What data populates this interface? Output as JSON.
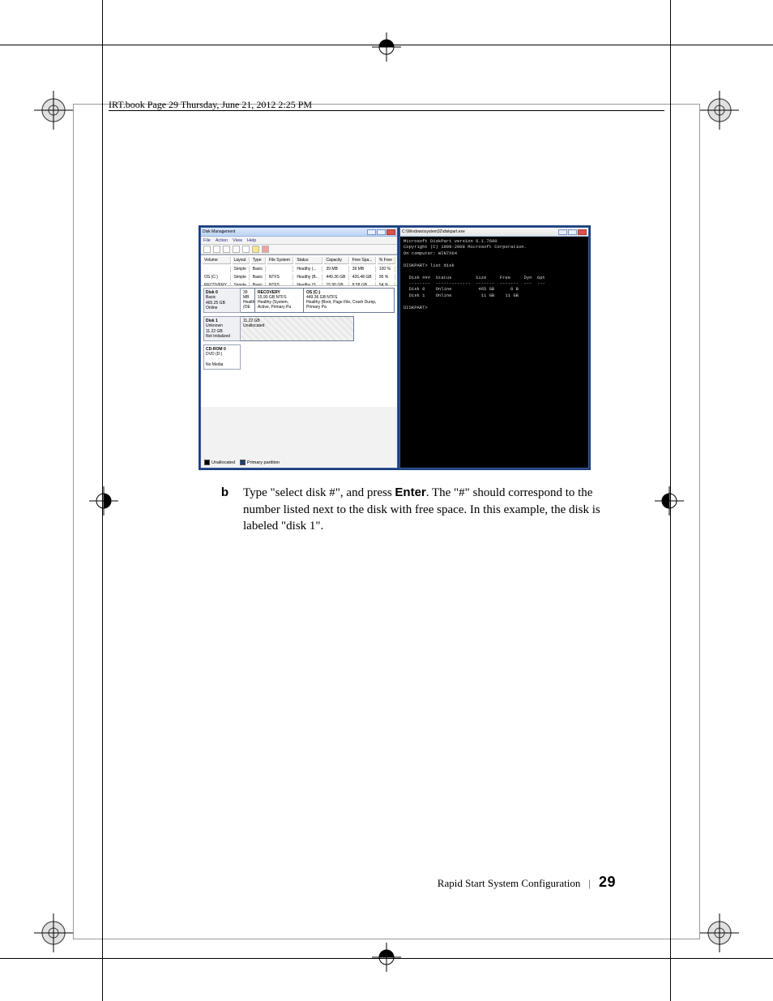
{
  "header_line": "IRT.book  Page 29  Thursday, June 21, 2012  2:25 PM",
  "screenshot": {
    "disk_management": {
      "title": "Disk Management",
      "menus": [
        "File",
        "Action",
        "View",
        "Help"
      ],
      "columns": [
        "Volume",
        "Layout",
        "Type",
        "File System",
        "Status",
        "Capacity",
        "Free Spa...",
        "% Free"
      ],
      "rows": [
        {
          "Volume": "",
          "Layout": "Simple",
          "Type": "Basic",
          "File System": "",
          "Status": "Healthy (...",
          "Capacity": "39 MB",
          "Free Spa...": "39 MB",
          "% Free": "100 %"
        },
        {
          "Volume": "OS (C:)",
          "Layout": "Simple",
          "Type": "Basic",
          "File System": "NTFS",
          "Status": "Healthy (B...",
          "Capacity": "449.36 GB",
          "Free Spa...": "426.48 GB",
          "% Free": "95 %"
        },
        {
          "Volume": "RECOVERY",
          "Layout": "Simple",
          "Type": "Basic",
          "File System": "NTFS",
          "Status": "Healthy (S...",
          "Capacity": "15.90 GB",
          "Free Spa...": "8.58 GB",
          "% Free": "54 %"
        }
      ],
      "disk0": {
        "name": "Disk 0",
        "kind": "Basic",
        "size": "465.25 GB",
        "state": "Online",
        "sys": {
          "size": "39 MB",
          "status": "Healthy (OE"
        },
        "recov": {
          "title": "RECOVERY",
          "size": "15.90 GB NTFS",
          "status": "Healthy (System, Active, Primary Pa"
        },
        "os": {
          "title": "OS (C:)",
          "size": "449.36 GB NTFS",
          "status": "Healthy (Boot, Page File, Crash Dump, Primary Pa"
        }
      },
      "disk1": {
        "name": "Disk 1",
        "kind": "Unknown",
        "size": "11.22 GB",
        "state": "Not Initialized",
        "unalloc_size": "11.22 GB",
        "unalloc_label": "Unallocated"
      },
      "cdrom": {
        "name": "CD-ROM 0",
        "drive": "DVD (D:)",
        "state": "No Media"
      },
      "legend": {
        "unallocated": "Unallocated",
        "primary": "Primary partition"
      }
    },
    "diskpart": {
      "title": "C:\\Windows\\system32\\diskpart.exe",
      "line1": "Microsoft DiskPart version 6.1.7600",
      "line2": "Copyright (C) 1999-2008 Microsoft Corporation.",
      "line3": "On computer: WIN7X64",
      "prompt1": "DISKPART> list disk",
      "table_hdr": "  Disk ###  Status         Size     Free     Dyn  Gpt",
      "table_sep": "  --------  -------------  -------  -------  ---  ---",
      "row0": "  Disk 0    Online          465 GB      0 B",
      "row1": "  Disk 1    Online           11 GB    11 GB",
      "prompt2": "DISKPART>"
    }
  },
  "step": {
    "bullet": "b",
    "t1": "Type \"select disk #\", and press ",
    "key": "Enter",
    "t2": ".  The \"#\" should correspond to the number listed next to the disk with free space.  In this example, the disk is labeled \"disk 1\"."
  },
  "footer": {
    "section": "Rapid Start System Configuration",
    "page": "29"
  }
}
